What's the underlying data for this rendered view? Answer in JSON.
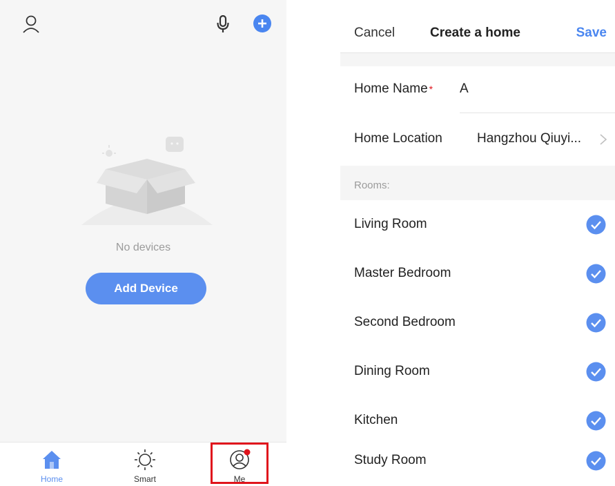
{
  "home_screen": {
    "empty_text": "No devices",
    "add_device_label": "Add Device",
    "tabs": [
      {
        "label": "Home",
        "icon": "home-icon"
      },
      {
        "label": "Smart",
        "icon": "sun-icon"
      },
      {
        "label": "Me",
        "icon": "user-circle-icon"
      }
    ],
    "accent": "#5b8fef"
  },
  "create_home": {
    "cancel_label": "Cancel",
    "title": "Create a home",
    "save_label": "Save",
    "home_name_label": "Home Name",
    "required_mark": "*",
    "home_name_value": "A",
    "home_location_label": "Home Location",
    "home_location_value": "Hangzhou Qiuyi...",
    "rooms_header": "Rooms:",
    "rooms": [
      {
        "name": "Living Room",
        "checked": true
      },
      {
        "name": "Master Bedroom",
        "checked": true
      },
      {
        "name": "Second Bedroom",
        "checked": true
      },
      {
        "name": "Dining Room",
        "checked": true
      },
      {
        "name": "Kitchen",
        "checked": true
      },
      {
        "name": "Study Room",
        "checked": true
      }
    ],
    "accent": "#4a86f0"
  }
}
